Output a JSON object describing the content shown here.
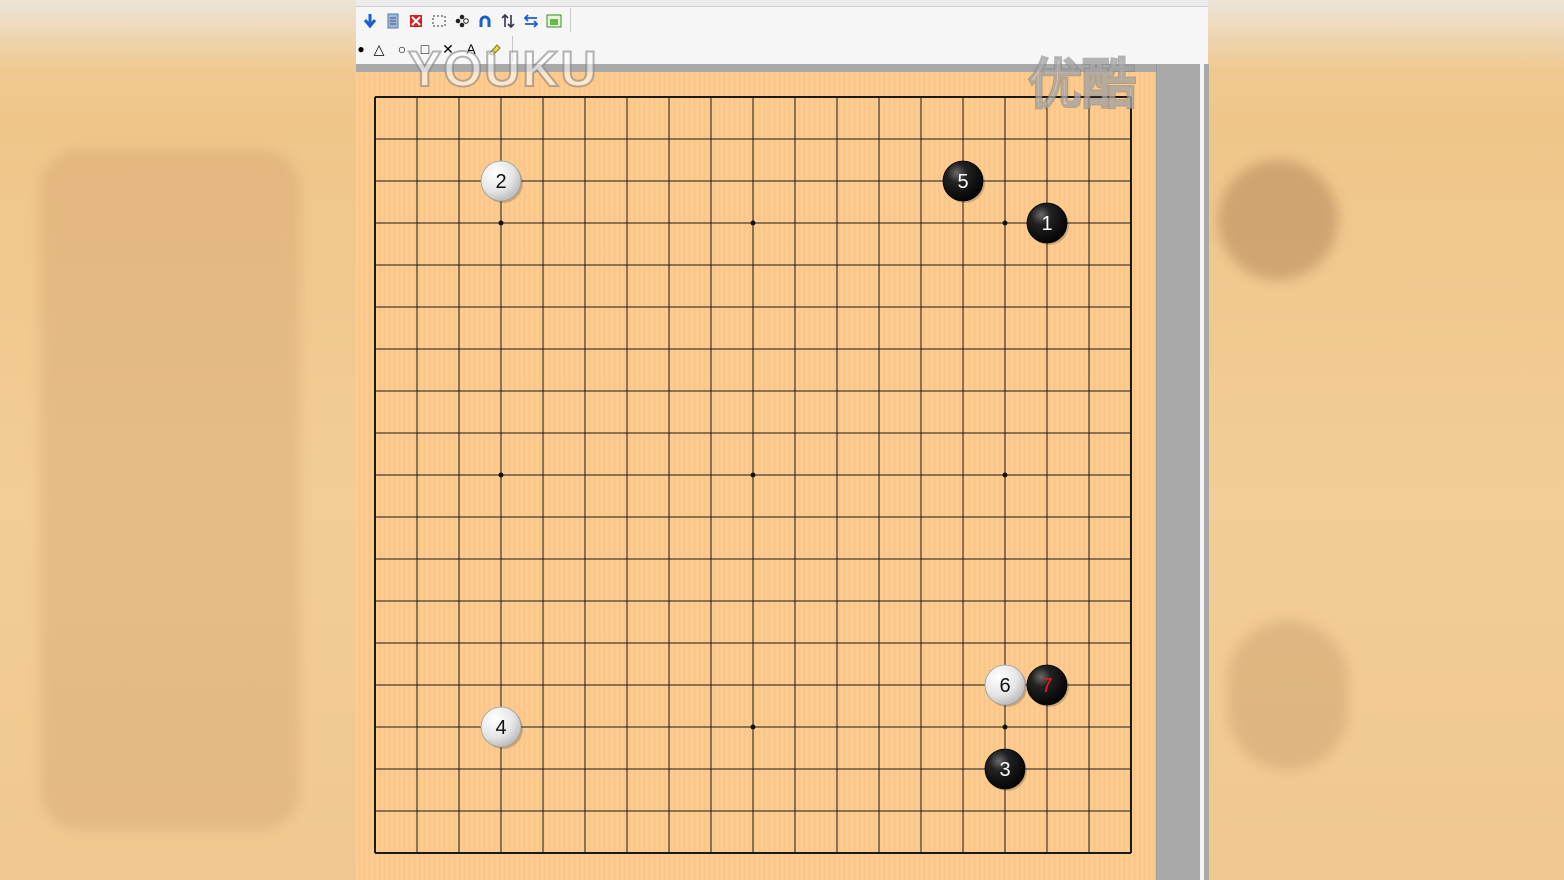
{
  "board": {
    "size": 19,
    "star_points": [
      [
        3,
        3
      ],
      [
        9,
        3
      ],
      [
        15,
        3
      ],
      [
        3,
        9
      ],
      [
        9,
        9
      ],
      [
        15,
        9
      ],
      [
        3,
        15
      ],
      [
        9,
        15
      ],
      [
        15,
        15
      ]
    ],
    "stones": [
      {
        "move": "1",
        "color": "black",
        "col": 16,
        "row": 3
      },
      {
        "move": "2",
        "color": "white",
        "col": 3,
        "row": 2
      },
      {
        "move": "3",
        "color": "black",
        "col": 15,
        "row": 16
      },
      {
        "move": "4",
        "color": "white",
        "col": 3,
        "row": 15
      },
      {
        "move": "5",
        "color": "black",
        "col": 14,
        "row": 2
      },
      {
        "move": "6",
        "color": "white",
        "col": 15,
        "row": 14
      },
      {
        "move": "7",
        "color": "black",
        "col": 16,
        "row": 14,
        "last": true
      }
    ],
    "last_move_number_color": "#e02020"
  },
  "toolbar": {
    "row1_icons": [
      "arrow-down-icon",
      "document-icon",
      "delete-icon",
      "select-rect-icon",
      "stones-pattern-icon",
      "undo-arc-icon",
      "swap-vertical-icon",
      "swap-horizontal-icon",
      "window-icon"
    ],
    "row2_tools": [
      {
        "name": "circle-stone-tool",
        "glyph": "●"
      },
      {
        "name": "triangle-tool",
        "glyph": "△"
      },
      {
        "name": "circle-tool",
        "glyph": "○"
      },
      {
        "name": "square-tool",
        "glyph": "□"
      },
      {
        "name": "cross-tool",
        "glyph": "✕"
      },
      {
        "name": "label-tool",
        "glyph": "A"
      },
      {
        "name": "eraser-tool",
        "glyph": "✎"
      }
    ]
  },
  "watermarks": {
    "en": "YOUKU",
    "cn": "优酷"
  },
  "colors": {
    "board": "#fdc98a",
    "black_stone": "#111111",
    "white_stone": "#eeeeee"
  }
}
